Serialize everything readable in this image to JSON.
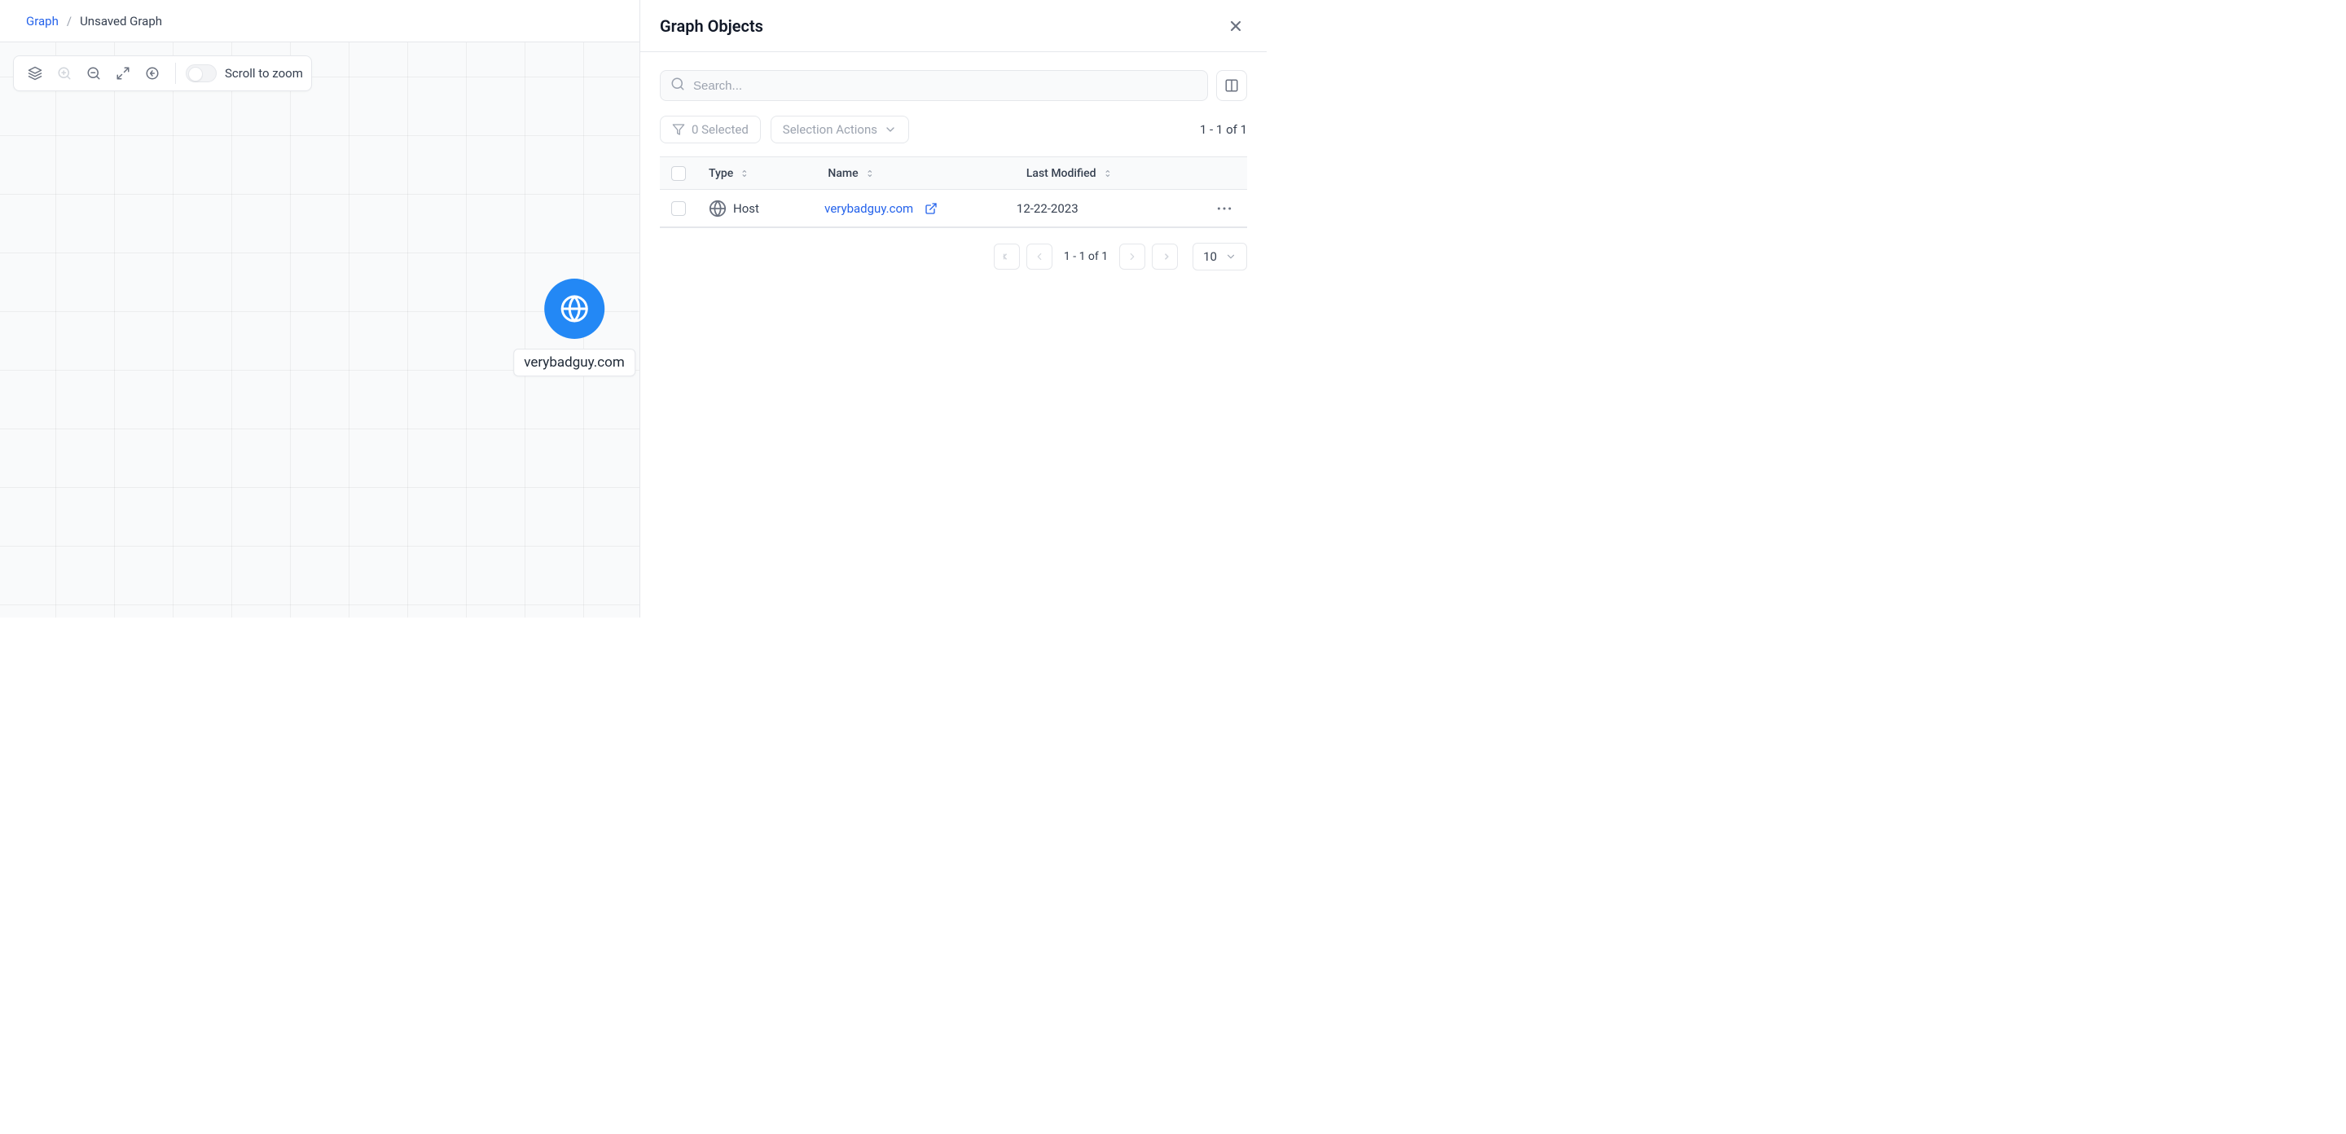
{
  "breadcrumb": {
    "root": "Graph",
    "current": "Unsaved Graph"
  },
  "toolbar": {
    "scroll_zoom_label": "Scroll to zoom"
  },
  "node": {
    "label": "verybadguy.com"
  },
  "panel": {
    "title": "Graph Objects",
    "search_placeholder": "Search...",
    "selected_label": "0 Selected",
    "selection_actions_label": "Selection Actions",
    "count_text": "1 - 1 of 1",
    "columns": {
      "type": "Type",
      "name": "Name",
      "last_modified": "Last Modified"
    },
    "rows": [
      {
        "type": "Host",
        "name": "verybadguy.com",
        "last_modified": "12-22-2023"
      }
    ],
    "pagination": {
      "range": "1 - 1 of 1",
      "page_size": "10"
    }
  }
}
